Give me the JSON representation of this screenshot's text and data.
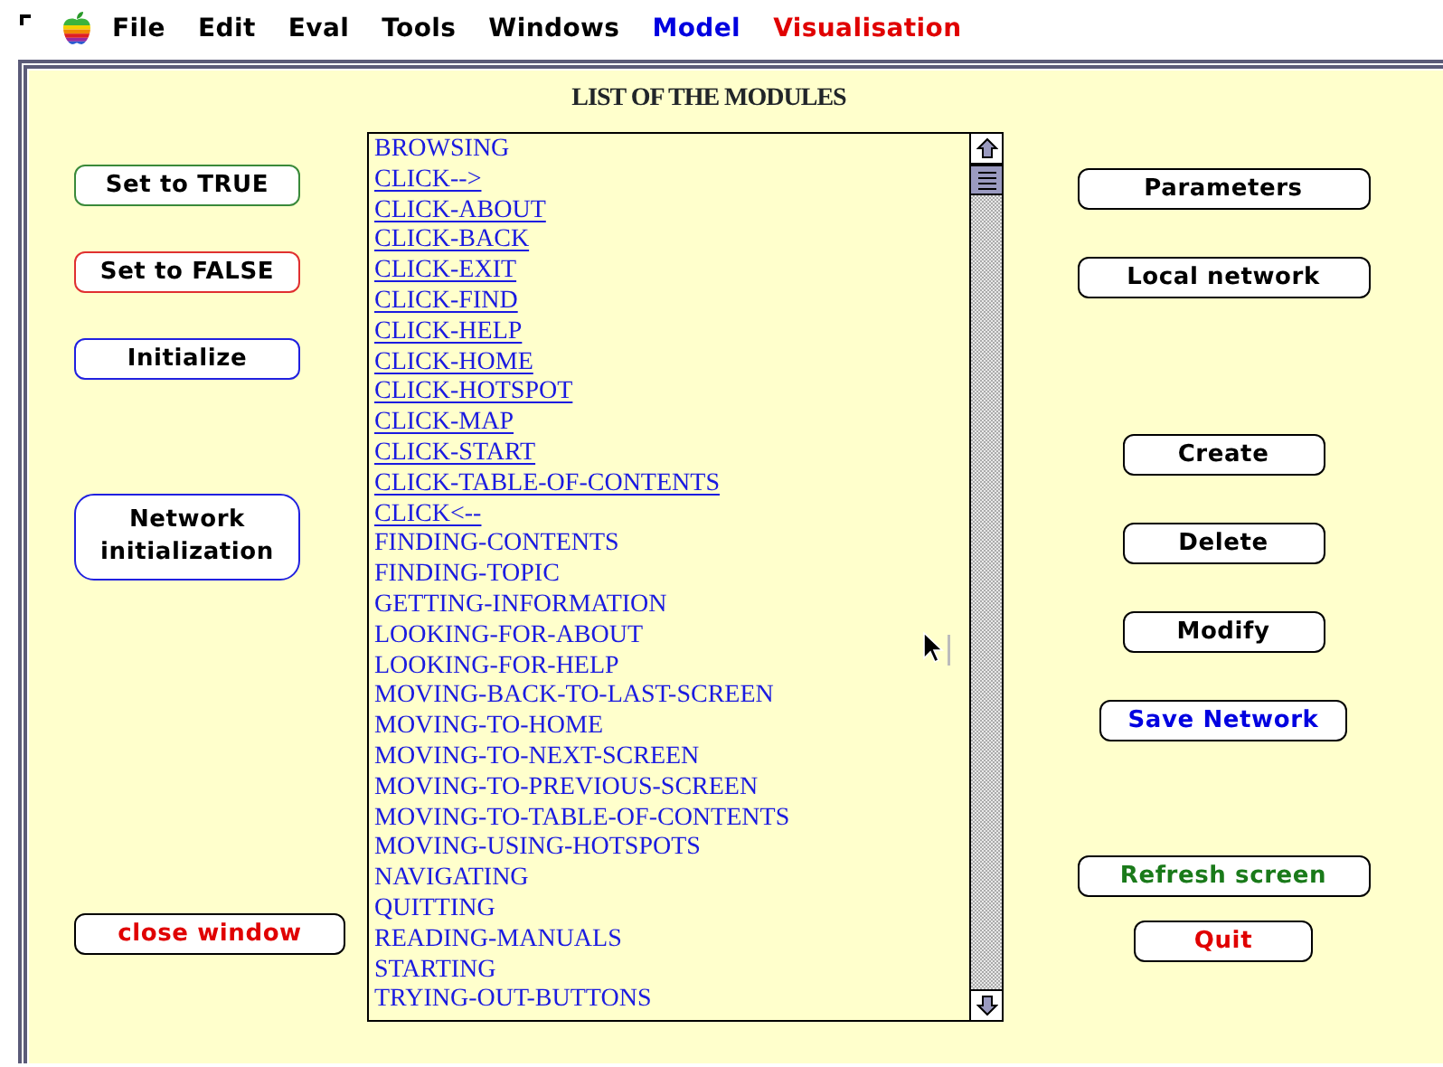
{
  "menu_bar": {
    "items": [
      {
        "label": "File",
        "color": "#000000"
      },
      {
        "label": "Edit",
        "color": "#000000"
      },
      {
        "label": "Eval",
        "color": "#000000"
      },
      {
        "label": "Tools",
        "color": "#000000"
      },
      {
        "label": "Windows",
        "color": "#000000"
      },
      {
        "label": "Model",
        "color": "#0000e0"
      },
      {
        "label": "Visualisation",
        "color": "#e00000"
      }
    ]
  },
  "panel": {
    "title": "LIST OF THE MODULES",
    "left_buttons": [
      {
        "label": "Set to TRUE",
        "kind": "outline",
        "color": "#3a8a3a"
      },
      {
        "label": "Set to FALSE",
        "kind": "outline",
        "color": "#e03030"
      },
      {
        "label": "Initialize",
        "kind": "outline",
        "color": "#2020e0"
      },
      {
        "label": "Network initialization",
        "kind": "outline",
        "color": "#2020e0"
      },
      {
        "label": "close window",
        "kind": "lettered",
        "color": "#e00000"
      }
    ],
    "modules": [
      {
        "label": "BROWSING",
        "linked": false
      },
      {
        "label": "CLICK-->",
        "linked": true
      },
      {
        "label": "CLICK-ABOUT",
        "linked": true
      },
      {
        "label": "CLICK-BACK",
        "linked": true
      },
      {
        "label": "CLICK-EXIT",
        "linked": true
      },
      {
        "label": "CLICK-FIND",
        "linked": true
      },
      {
        "label": "CLICK-HELP",
        "linked": true
      },
      {
        "label": "CLICK-HOME",
        "linked": true
      },
      {
        "label": "CLICK-HOTSPOT",
        "linked": true
      },
      {
        "label": "CLICK-MAP",
        "linked": true
      },
      {
        "label": "CLICK-START",
        "linked": true
      },
      {
        "label": "CLICK-TABLE-OF-CONTENTS",
        "linked": true
      },
      {
        "label": "CLICK<--",
        "linked": true
      },
      {
        "label": "FINDING-CONTENTS",
        "linked": false
      },
      {
        "label": "FINDING-TOPIC",
        "linked": false
      },
      {
        "label": "GETTING-INFORMATION",
        "linked": false
      },
      {
        "label": "LOOKING-FOR-ABOUT",
        "linked": false
      },
      {
        "label": "LOOKING-FOR-HELP",
        "linked": false
      },
      {
        "label": "MOVING-BACK-TO-LAST-SCREEN",
        "linked": false
      },
      {
        "label": "MOVING-TO-HOME",
        "linked": false
      },
      {
        "label": "MOVING-TO-NEXT-SCREEN",
        "linked": false
      },
      {
        "label": "MOVING-TO-PREVIOUS-SCREEN",
        "linked": false
      },
      {
        "label": "MOVING-TO-TABLE-OF-CONTENTS",
        "linked": false
      },
      {
        "label": "MOVING-USING-HOTSPOTS",
        "linked": false
      },
      {
        "label": "NAVIGATING",
        "linked": false
      },
      {
        "label": "QUITTING",
        "linked": false
      },
      {
        "label": "READING-MANUALS",
        "linked": false
      },
      {
        "label": "STARTING",
        "linked": false
      },
      {
        "label": "TRYING-OUT-BUTTONS",
        "linked": false
      }
    ],
    "right_buttons": [
      {
        "label": "Parameters",
        "kind": "lettered",
        "color": "#000000"
      },
      {
        "label": "Local network",
        "kind": "lettered",
        "color": "#000000"
      },
      {
        "label": "Create",
        "kind": "lettered",
        "color": "#000000"
      },
      {
        "label": "Delete",
        "kind": "lettered",
        "color": "#000000"
      },
      {
        "label": "Modify",
        "kind": "lettered",
        "color": "#000000"
      },
      {
        "label": "Save Network",
        "kind": "lettered",
        "color": "#0000e0"
      },
      {
        "label": "Refresh screen",
        "kind": "lettered",
        "color": "#1a7a1a"
      },
      {
        "label": "Quit",
        "kind": "lettered",
        "color": "#e00000"
      }
    ]
  }
}
